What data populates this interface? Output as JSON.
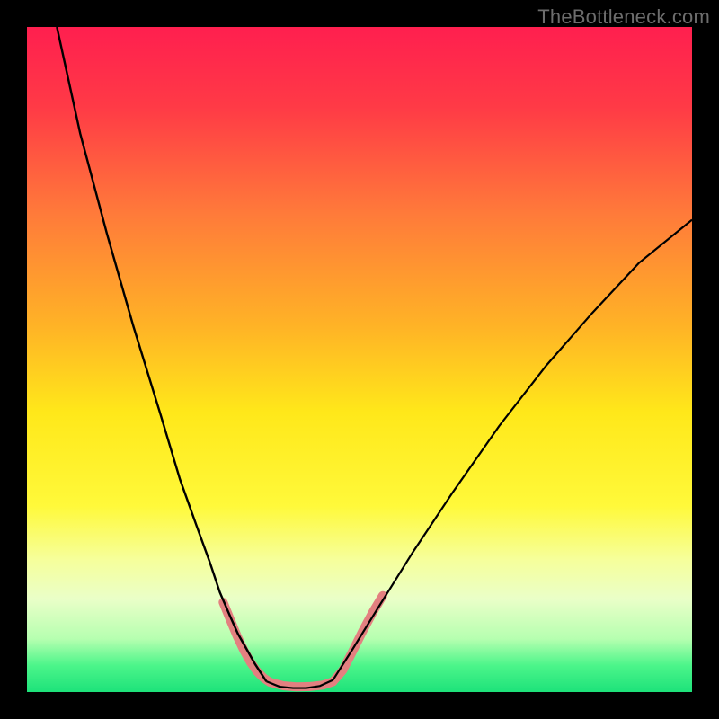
{
  "watermark": {
    "text": "TheBottleneck.com"
  },
  "chart_data": {
    "type": "line",
    "title": "",
    "xlabel": "",
    "ylabel": "",
    "xlim": [
      0,
      100
    ],
    "ylim": [
      0,
      100
    ],
    "grid": false,
    "legend": false,
    "note": "Bottleneck-style curve over a red→yellow→green gradient background. Axis values are estimated from pixel positions as percentages of the plot extent (0–100). Lower y is better (green band near bottom).",
    "background_gradient_stops": [
      {
        "pct": 0,
        "color": "#ff1f4f"
      },
      {
        "pct": 12,
        "color": "#ff3a46"
      },
      {
        "pct": 28,
        "color": "#ff7a3a"
      },
      {
        "pct": 45,
        "color": "#ffb326"
      },
      {
        "pct": 58,
        "color": "#ffe81a"
      },
      {
        "pct": 72,
        "color": "#fff93a"
      },
      {
        "pct": 80,
        "color": "#f6ff9a"
      },
      {
        "pct": 86,
        "color": "#eaffc8"
      },
      {
        "pct": 92,
        "color": "#b6ffb0"
      },
      {
        "pct": 96,
        "color": "#4cf58a"
      },
      {
        "pct": 100,
        "color": "#1de27a"
      }
    ],
    "series": [
      {
        "name": "left-branch",
        "x": [
          4.5,
          8,
          12,
          16,
          20,
          23,
          25.5,
          27.5,
          29,
          30.5,
          31.7,
          33,
          34.3,
          36
        ],
        "y": [
          100,
          84,
          69,
          55,
          42,
          32,
          25,
          19.5,
          15,
          11.5,
          8.8,
          6.5,
          4.2,
          1.6
        ],
        "stroke": "#000000",
        "width": 2.4
      },
      {
        "name": "valley-floor",
        "x": [
          36,
          38,
          40,
          42,
          44,
          46
        ],
        "y": [
          1.6,
          0.8,
          0.6,
          0.6,
          0.9,
          1.8
        ],
        "stroke": "#000000",
        "width": 2.2
      },
      {
        "name": "right-branch",
        "x": [
          46,
          49,
          53,
          58,
          64,
          71,
          78,
          85,
          92,
          100
        ],
        "y": [
          1.8,
          6.5,
          13,
          21,
          30,
          40,
          49,
          57,
          64.5,
          71
        ],
        "stroke": "#000000",
        "width": 2.2
      },
      {
        "name": "left-highlight",
        "x": [
          29.5,
          30.6,
          31.6,
          32.6,
          33.6,
          34.6,
          35.6,
          36.5
        ],
        "y": [
          13.5,
          10.8,
          8.4,
          6.3,
          4.5,
          3.1,
          2.1,
          1.5
        ],
        "stroke": "#e38080",
        "width": 10,
        "linecap": "round"
      },
      {
        "name": "floor-highlight",
        "x": [
          36.5,
          38.5,
          40.5,
          42.5,
          44.5,
          46
        ],
        "y": [
          1.5,
          0.95,
          0.78,
          0.82,
          1.05,
          1.55
        ],
        "stroke": "#e38080",
        "width": 10,
        "linecap": "round"
      },
      {
        "name": "right-highlight",
        "x": [
          46,
          47.5,
          49,
          50.5,
          52,
          53.5
        ],
        "y": [
          1.55,
          3.3,
          6.2,
          9.2,
          12,
          14.5
        ],
        "stroke": "#e38080",
        "width": 10,
        "linecap": "round"
      }
    ]
  }
}
